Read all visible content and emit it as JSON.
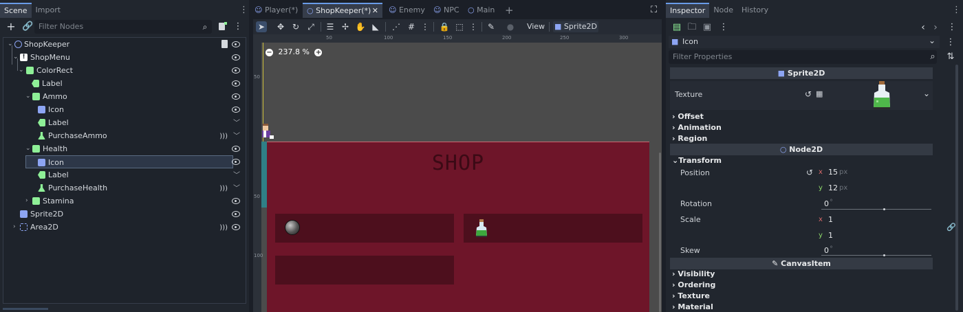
{
  "scene_dock": {
    "tabs": [
      "Scene",
      "Import"
    ],
    "filter_placeholder": "Filter Nodes",
    "tree": [
      {
        "label": "ShopKeeper",
        "icon": "node2d-icon"
      },
      {
        "label": "ShopMenu",
        "icon": "alert-icon"
      },
      {
        "label": "ColorRect",
        "icon": "colorrect-icon"
      },
      {
        "label": "Label",
        "icon": "label-icon"
      },
      {
        "label": "Ammo",
        "icon": "colorrect-icon"
      },
      {
        "label": "Icon",
        "icon": "sprite2d-icon"
      },
      {
        "label": "Label",
        "icon": "label-icon"
      },
      {
        "label": "PurchaseAmmo",
        "icon": "button-icon"
      },
      {
        "label": "Health",
        "icon": "colorrect-icon"
      },
      {
        "label": "Icon",
        "icon": "sprite2d-icon"
      },
      {
        "label": "Label",
        "icon": "label-icon"
      },
      {
        "label": "PurchaseHealth",
        "icon": "button-icon"
      },
      {
        "label": "Stamina",
        "icon": "colorrect-icon"
      },
      {
        "label": "Sprite2D",
        "icon": "sprite2d-icon"
      },
      {
        "label": "Area2D",
        "icon": "area2d-icon"
      }
    ]
  },
  "editor": {
    "scene_tabs": [
      "Player(*)",
      "ShopKeeper(*)",
      "Enemy",
      "NPC",
      "Main"
    ],
    "view_label": "View",
    "sprite_button": "Sprite2D",
    "zoom": "237.8 %",
    "ruler_top": [
      "50",
      "100",
      "150",
      "200",
      "250",
      "300"
    ],
    "ruler_left": [
      "50",
      "50",
      "100"
    ],
    "shop_title": "SHOP"
  },
  "inspector": {
    "tabs": [
      "Inspector",
      "Node",
      "History"
    ],
    "object_name": "Icon",
    "filter_placeholder": "Filter Properties",
    "sprite_header": "Sprite2D",
    "texture_label": "Texture",
    "sections_sprite": [
      "Offset",
      "Animation",
      "Region"
    ],
    "node2d_header": "Node2D",
    "transform_label": "Transform",
    "position_label": "Position",
    "position_x": "15",
    "position_y": "12",
    "unit_px": "px",
    "rotation_label": "Rotation",
    "rotation_value": "0",
    "degree": "°",
    "scale_label": "Scale",
    "scale_x": "1",
    "scale_y": "1",
    "skew_label": "Skew",
    "skew_value": "0",
    "canvasitem_header": "CanvasItem",
    "sections_canvas": [
      "Visibility",
      "Ordering",
      "Texture",
      "Material"
    ],
    "axis_x": "x",
    "axis_y": "y"
  },
  "colors": {
    "accent": "#699ce8",
    "node_blue": "#8da5f3",
    "control_green": "#8eef97",
    "shop_red": "#6e1529",
    "slot_red": "#4d0f1d"
  }
}
